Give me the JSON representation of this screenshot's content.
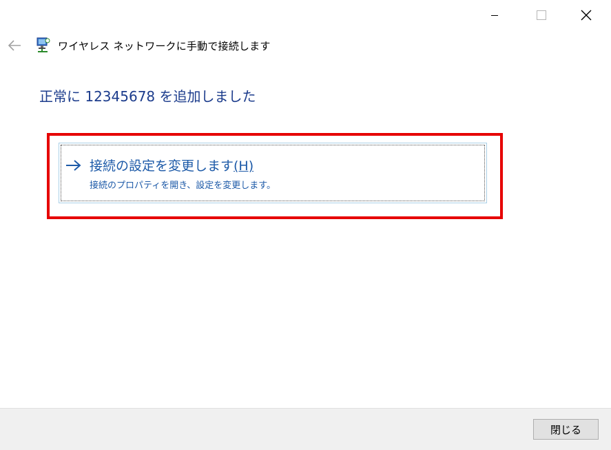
{
  "window": {
    "caption_buttons": {
      "minimize_icon": "minimize-icon",
      "maximize_icon": "maximize-icon",
      "close_icon": "close-icon"
    }
  },
  "header": {
    "back_icon": "back-arrow-icon",
    "app_icon": "network-wizard-icon",
    "title": "ワイヤレス ネットワークに手動で接続します"
  },
  "main": {
    "heading": "正常に 12345678 を追加しました",
    "command_link": {
      "icon": "right-arrow-icon",
      "title": "接続の設定を変更します",
      "accelerator": "(H)",
      "description": "接続のプロパティを開き、設定を変更します。"
    }
  },
  "footer": {
    "close_label": "閉じる"
  },
  "colors": {
    "heading": "#1c3c8c",
    "link": "#1d5aa8",
    "highlight": "#e60000",
    "footer_bg": "#f0f0f0"
  }
}
